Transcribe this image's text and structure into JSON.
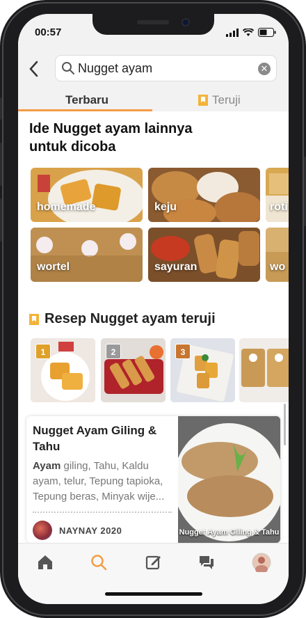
{
  "status": {
    "time": "00:57"
  },
  "search": {
    "query": "Nugget ayam",
    "clear_icon": "close-circle-icon"
  },
  "tabs": [
    {
      "label": "Terbaru",
      "active": true
    },
    {
      "label": "Teruji",
      "active": false,
      "icon": "bookmark-badge-icon"
    }
  ],
  "ideas": {
    "title": "Ide Nugget ayam lainnya untuk dicoba",
    "tiles": [
      {
        "label": "homemade",
        "color": "#d9a24a"
      },
      {
        "label": "keju",
        "color": "#b8773a"
      },
      {
        "label": "roti",
        "color": "#c8953a"
      },
      {
        "label": "wortel",
        "color": "#b48649"
      },
      {
        "label": "sayuran",
        "color": "#a86a3a"
      },
      {
        "label": "wo",
        "color": "#c79a56"
      }
    ]
  },
  "tested": {
    "title": "Resep Nugget ayam teruji",
    "ranks": [
      "1",
      "2",
      "3"
    ]
  },
  "recipe_card": {
    "title": "Nugget Ayam Giling & Tahu",
    "ingredients_bold": "Ayam",
    "ingredients_rest": " giling, Tahu, Kaldu ayam, telur, Tepung tapioka, Tepung beras, Minyak wije...",
    "author": "NAYNAY 2020",
    "image_caption": "Nugget Ayam Giling & Tahu"
  },
  "nav": {
    "items": [
      "home-icon",
      "search-icon",
      "edit-icon",
      "chat-icon",
      "profile-avatar"
    ],
    "active_color": "#f39c45"
  },
  "colors": {
    "accent": "#f39c45",
    "medal_gold": "#e0a12a",
    "medal_silver": "#9a9a9a",
    "medal_bronze": "#c87530"
  }
}
